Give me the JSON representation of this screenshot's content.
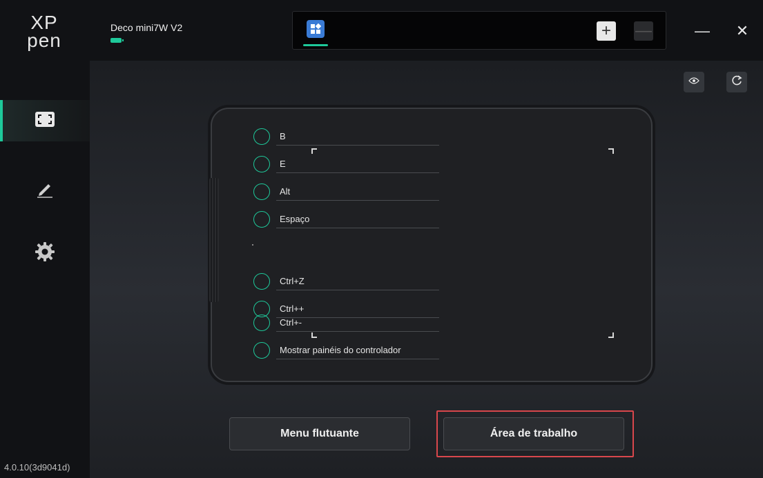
{
  "app": {
    "logo_top": "XP",
    "logo_bottom": "pen",
    "version": "4.0.10(3d9041d)",
    "accent_color": "#1ec99a"
  },
  "sidebar": {
    "items": [
      {
        "name": "work-area",
        "icon": "frame-icon",
        "active": true
      },
      {
        "name": "pen",
        "icon": "pen-icon",
        "active": false
      },
      {
        "name": "settings",
        "icon": "gear-icon",
        "active": false
      }
    ]
  },
  "device": {
    "name": "Deco mini7W V2",
    "battery_icon": "battery-icon"
  },
  "app_tabs": {
    "selected_icon": "app-grid-icon",
    "add_label": "+",
    "remove_label": "—"
  },
  "window": {
    "minimize_label": "—",
    "close_label": "✕"
  },
  "toolbar": {
    "preview_icon": "eye-icon",
    "reset_icon": "refresh-icon"
  },
  "express_keys": [
    {
      "label": "B"
    },
    {
      "label": "E"
    },
    {
      "label": "Alt"
    },
    {
      "label": "Espaço"
    },
    {
      "label": "Ctrl+Z"
    },
    {
      "label": "Ctrl++"
    },
    {
      "label": "Ctrl+-"
    },
    {
      "label": "Mostrar painéis do controlador"
    }
  ],
  "buttons": {
    "floating_menu": "Menu flutuante",
    "workspace": "Área de trabalho",
    "highlight_color": "#d9474c"
  }
}
